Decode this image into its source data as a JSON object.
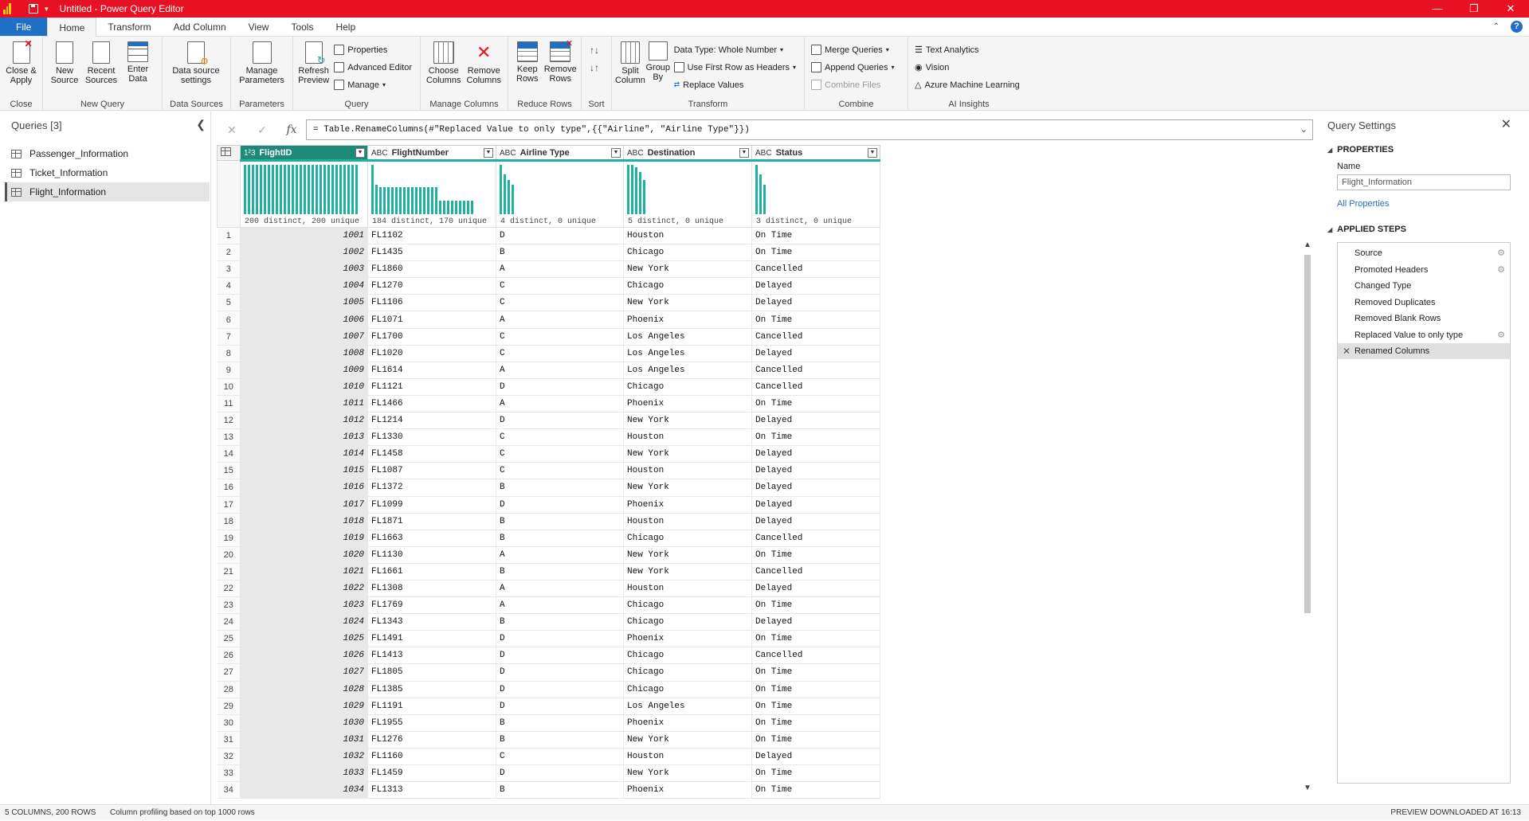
{
  "window": {
    "title": "Untitled - Power Query Editor"
  },
  "tabs": [
    "File",
    "Home",
    "Transform",
    "Add Column",
    "View",
    "Tools",
    "Help"
  ],
  "ribbon": {
    "close_apply": "Close &\nApply",
    "close_label": "Close",
    "new_source": "New\nSource",
    "recent_sources": "Recent\nSources",
    "enter_data": "Enter\nData",
    "new_query_label": "New Query",
    "data_source_settings": "Data source\nsettings",
    "data_sources_label": "Data Sources",
    "manage_parameters": "Manage\nParameters",
    "parameters_label": "Parameters",
    "refresh_preview": "Refresh\nPreview",
    "properties": "Properties",
    "advanced_editor": "Advanced Editor",
    "manage": "Manage",
    "query_label": "Query",
    "choose_columns": "Choose\nColumns",
    "remove_columns": "Remove\nColumns",
    "manage_columns_label": "Manage Columns",
    "keep_rows": "Keep\nRows",
    "remove_rows": "Remove\nRows",
    "reduce_rows_label": "Reduce Rows",
    "sort_label": "Sort",
    "split_column": "Split\nColumn",
    "group_by": "Group\nBy",
    "data_type": "Data Type: Whole Number",
    "first_row_headers": "Use First Row as Headers",
    "replace_values": "Replace Values",
    "transform_label": "Transform",
    "merge_queries": "Merge Queries",
    "append_queries": "Append Queries",
    "combine_files": "Combine Files",
    "combine_label": "Combine",
    "text_analytics": "Text Analytics",
    "vision": "Vision",
    "azure_ml": "Azure Machine Learning",
    "ai_insights_label": "AI Insights"
  },
  "queries": {
    "header": "Queries [3]",
    "items": [
      {
        "label": "Passenger_Information"
      },
      {
        "label": "Ticket_Information"
      },
      {
        "label": "Flight_Information"
      }
    ]
  },
  "formula": "= Table.RenameColumns(#\"Replaced Value to only type\",{{\"Airline\", \"Airline Type\"}})",
  "columns": [
    {
      "type": "1²3",
      "name": "FlightID",
      "profile": "200 distinct, 200 unique",
      "bars": [
        1,
        1,
        1,
        1,
        1,
        1,
        1,
        1,
        1,
        1,
        1,
        1,
        1,
        1,
        1,
        1,
        1,
        1,
        1,
        1,
        1,
        1,
        1,
        1,
        1,
        1,
        1,
        1,
        1
      ]
    },
    {
      "type": "ABC",
      "name": "FlightNumber",
      "profile": "184 distinct, 170 unique",
      "bars": [
        1,
        0.6,
        0.55,
        0.55,
        0.55,
        0.55,
        0.55,
        0.55,
        0.55,
        0.55,
        0.55,
        0.55,
        0.55,
        0.55,
        0.55,
        0.55,
        0.55,
        0.27,
        0.27,
        0.27,
        0.27,
        0.27,
        0.27,
        0.27,
        0.27,
        0.27
      ]
    },
    {
      "type": "ABC",
      "name": "Airline Type",
      "profile": "4 distinct, 0 unique",
      "bars": [
        1,
        0.8,
        0.7,
        0.6
      ]
    },
    {
      "type": "ABC",
      "name": "Destination",
      "profile": "5 distinct, 0 unique",
      "bars": [
        1,
        1,
        0.95,
        0.85,
        0.7
      ]
    },
    {
      "type": "ABC",
      "name": "Status",
      "profile": "3 distinct, 0 unique",
      "bars": [
        1,
        0.8,
        0.6
      ]
    }
  ],
  "rows": [
    [
      "1001",
      "FL1102",
      "D",
      "Houston",
      "On Time"
    ],
    [
      "1002",
      "FL1435",
      "B",
      "Chicago",
      "On Time"
    ],
    [
      "1003",
      "FL1860",
      "A",
      "New York",
      "Cancelled"
    ],
    [
      "1004",
      "FL1270",
      "C",
      "Chicago",
      "Delayed"
    ],
    [
      "1005",
      "FL1106",
      "C",
      "New York",
      "Delayed"
    ],
    [
      "1006",
      "FL1071",
      "A",
      "Phoenix",
      "On Time"
    ],
    [
      "1007",
      "FL1700",
      "C",
      "Los Angeles",
      "Cancelled"
    ],
    [
      "1008",
      "FL1020",
      "C",
      "Los Angeles",
      "Delayed"
    ],
    [
      "1009",
      "FL1614",
      "A",
      "Los Angeles",
      "Cancelled"
    ],
    [
      "1010",
      "FL1121",
      "D",
      "Chicago",
      "Cancelled"
    ],
    [
      "1011",
      "FL1466",
      "A",
      "Phoenix",
      "On Time"
    ],
    [
      "1012",
      "FL1214",
      "D",
      "New York",
      "Delayed"
    ],
    [
      "1013",
      "FL1330",
      "C",
      "Houston",
      "On Time"
    ],
    [
      "1014",
      "FL1458",
      "C",
      "New York",
      "Delayed"
    ],
    [
      "1015",
      "FL1087",
      "C",
      "Houston",
      "Delayed"
    ],
    [
      "1016",
      "FL1372",
      "B",
      "New York",
      "Delayed"
    ],
    [
      "1017",
      "FL1099",
      "D",
      "Phoenix",
      "Delayed"
    ],
    [
      "1018",
      "FL1871",
      "B",
      "Houston",
      "Delayed"
    ],
    [
      "1019",
      "FL1663",
      "B",
      "Chicago",
      "Cancelled"
    ],
    [
      "1020",
      "FL1130",
      "A",
      "New York",
      "On Time"
    ],
    [
      "1021",
      "FL1661",
      "B",
      "New York",
      "Cancelled"
    ],
    [
      "1022",
      "FL1308",
      "A",
      "Houston",
      "Delayed"
    ],
    [
      "1023",
      "FL1769",
      "A",
      "Chicago",
      "On Time"
    ],
    [
      "1024",
      "FL1343",
      "B",
      "Chicago",
      "Delayed"
    ],
    [
      "1025",
      "FL1491",
      "D",
      "Phoenix",
      "On Time"
    ],
    [
      "1026",
      "FL1413",
      "D",
      "Chicago",
      "Cancelled"
    ],
    [
      "1027",
      "FL1805",
      "D",
      "Chicago",
      "On Time"
    ],
    [
      "1028",
      "FL1385",
      "D",
      "Chicago",
      "On Time"
    ],
    [
      "1029",
      "FL1191",
      "D",
      "Los Angeles",
      "On Time"
    ],
    [
      "1030",
      "FL1955",
      "B",
      "Phoenix",
      "On Time"
    ],
    [
      "1031",
      "FL1276",
      "B",
      "New York",
      "On Time"
    ],
    [
      "1032",
      "FL1160",
      "C",
      "Houston",
      "Delayed"
    ],
    [
      "1033",
      "FL1459",
      "D",
      "New York",
      "On Time"
    ],
    [
      "1034",
      "FL1313",
      "B",
      "Phoenix",
      "On Time"
    ]
  ],
  "settings": {
    "header": "Query Settings",
    "properties": "PROPERTIES",
    "name_label": "Name",
    "name_value": "Flight_Information",
    "all_properties": "All Properties",
    "applied_steps": "APPLIED STEPS",
    "steps": [
      {
        "label": "Source",
        "gear": true
      },
      {
        "label": "Promoted Headers",
        "gear": true
      },
      {
        "label": "Changed Type",
        "gear": false
      },
      {
        "label": "Removed Duplicates",
        "gear": false
      },
      {
        "label": "Removed Blank Rows",
        "gear": false
      },
      {
        "label": "Replaced Value to only type",
        "gear": true
      },
      {
        "label": "Renamed Columns",
        "gear": false,
        "selected": true
      }
    ]
  },
  "status": {
    "left": "5 COLUMNS, 200 ROWS",
    "middle": "Column profiling based on top 1000 rows",
    "right": "PREVIEW DOWNLOADED AT 16:13"
  },
  "colors": {
    "accent": "#1eb1a0",
    "titlebar": "#e81123",
    "file_tab": "#1f6fc5",
    "selected_header": "#1e8978"
  }
}
